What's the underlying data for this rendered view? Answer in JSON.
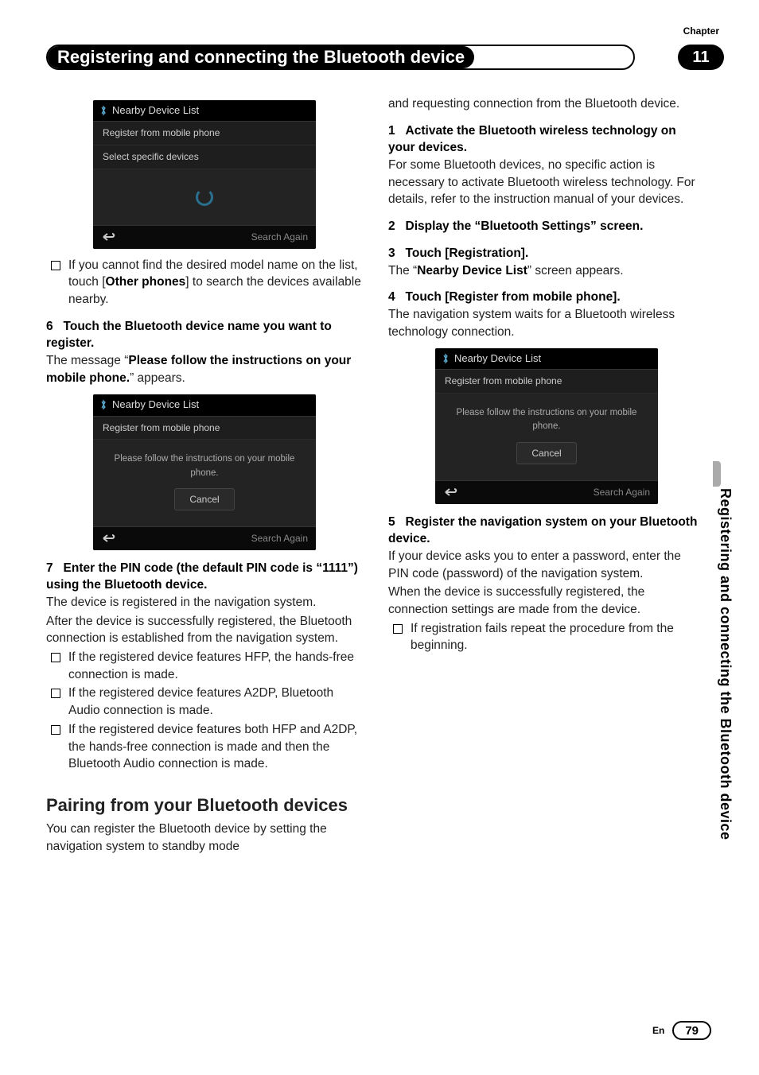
{
  "chapter": {
    "label": "Chapter",
    "number": "11",
    "title": "Registering and connecting the Bluetooth device"
  },
  "side_tab": "Registering and connecting the Bluetooth device",
  "footer": {
    "lang": "En",
    "page": "79"
  },
  "fig1": {
    "title": "Nearby Device List",
    "row1": "Register from mobile phone",
    "row2": "Select specific devices",
    "search": "Search Again"
  },
  "fig2": {
    "title": "Nearby Device List",
    "row1": "Register from mobile phone",
    "msg": "Please follow the instructions on your mobile phone.",
    "cancel": "Cancel",
    "search": "Search Again"
  },
  "fig3": {
    "title": "Nearby Device List",
    "row1": "Register from mobile phone",
    "msg": "Please follow the instructions on your mobile phone.",
    "cancel": "Cancel",
    "search": "Search Again"
  },
  "left": {
    "note1a": "If you cannot find the desired model name on the list, touch [",
    "note1b": "Other phones",
    "note1c": "] to search the devices available nearby.",
    "s6_num": "6",
    "s6_head": "Touch the Bluetooth device name you want to register.",
    "s6_p1a": "The message “",
    "s6_p1b": "Please follow the instructions on your mobile phone.",
    "s6_p1c": "” appears.",
    "s7_num": "7",
    "s7_head": "Enter the PIN code (the default PIN code is “1111”) using the Bluetooth device.",
    "s7_p1": "The device is registered in the navigation system.",
    "s7_p2": "After the device is successfully registered, the Bluetooth connection is established from the navigation system.",
    "s7_b1": "If the registered device features HFP, the hands-free connection is made.",
    "s7_b2": "If the registered device features A2DP, Bluetooth Audio connection is made.",
    "s7_b3": "If the registered device features both HFP and A2DP, the hands-free connection is made and then the Bluetooth Audio connection is made.",
    "sec_title": "Pairing from your Bluetooth devices",
    "sec_p1": "You can register the Bluetooth device by setting the navigation system to standby mode"
  },
  "right": {
    "cont": "and requesting connection from the Bluetooth device.",
    "s1_num": "1",
    "s1_head": "Activate the Bluetooth wireless technology on your devices.",
    "s1_p1": "For some Bluetooth devices, no specific action is necessary to activate Bluetooth wireless technology. For details, refer to the instruction manual of your devices.",
    "s2_num": "2",
    "s2_head": "Display the “Bluetooth Settings” screen.",
    "s3_num": "3",
    "s3_head": "Touch [Registration].",
    "s3_p1a": "The “",
    "s3_p1b": "Nearby Device List",
    "s3_p1c": "” screen appears.",
    "s4_num": "4",
    "s4_head": "Touch [Register from mobile phone].",
    "s4_p1": "The navigation system waits for a Bluetooth wireless technology connection.",
    "s5_num": "5",
    "s5_head": "Register the navigation system on your Bluetooth device.",
    "s5_p1": "If your device asks you to enter a password, enter the PIN code (password) of the navigation system.",
    "s5_p2": "When the device is successfully registered, the connection settings are made from the device.",
    "s5_b1": "If registration fails repeat the procedure from the beginning."
  }
}
